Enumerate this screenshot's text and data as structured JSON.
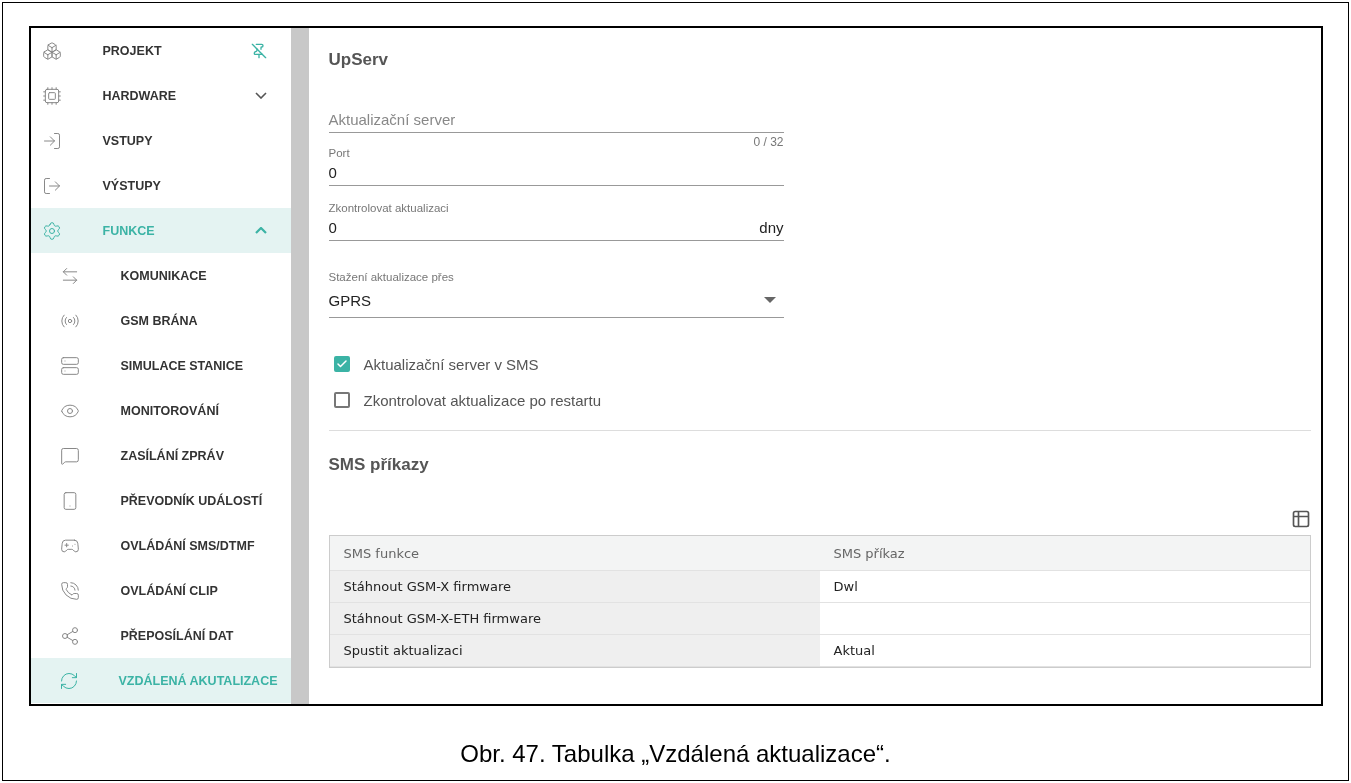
{
  "sidebar": {
    "items": [
      {
        "label": "PROJEKT",
        "selected": false,
        "pinned": true
      },
      {
        "label": "HARDWARE",
        "selected": false,
        "expanded": false
      },
      {
        "label": "VSTUPY",
        "selected": false
      },
      {
        "label": "VÝSTUPY",
        "selected": false
      },
      {
        "label": "FUNKCE",
        "selected": true,
        "expanded": true,
        "children": [
          {
            "label": "KOMUNIKACE",
            "selected": false
          },
          {
            "label": "GSM BRÁNA",
            "selected": false
          },
          {
            "label": "SIMULACE STANICE",
            "selected": false
          },
          {
            "label": "MONITOROVÁNÍ",
            "selected": false
          },
          {
            "label": "ZASÍLÁNÍ ZPRÁV",
            "selected": false
          },
          {
            "label": "PŘEVODNÍK UDÁLOSTÍ",
            "selected": false
          },
          {
            "label": "OVLÁDÁNÍ SMS/DTMF",
            "selected": false
          },
          {
            "label": "OVLÁDÁNÍ CLIP",
            "selected": false
          },
          {
            "label": "PŘEPOSÍLÁNÍ DAT",
            "selected": false
          },
          {
            "label": "VZDÁLENÁ AKUTALIZACE",
            "selected": true
          }
        ]
      }
    ]
  },
  "upserv": {
    "title": "UpServ",
    "fields": [
      {
        "kind": "text",
        "placeholder": "Aktualizační server",
        "counter": "0 / 32"
      },
      {
        "kind": "number",
        "label": "Port",
        "value": "0"
      },
      {
        "kind": "number",
        "label": "Zkontrolovat aktualizaci",
        "value": "0",
        "suffix": "dny"
      },
      {
        "kind": "select",
        "label": "Stažení aktualizace přes",
        "value": "GPRS"
      }
    ],
    "checkboxes": [
      {
        "label": "Aktualizační server v SMS",
        "checked": true
      },
      {
        "label": "Zkontrolovat aktualizace po restartu",
        "checked": false
      }
    ]
  },
  "sms": {
    "title": "SMS příkazy",
    "table": {
      "columns": [
        "SMS funkce",
        "SMS příkaz"
      ],
      "rows": [
        [
          "Stáhnout GSM-X firmware",
          "Dwl"
        ],
        [
          "Stáhnout GSM-X-ETH firmware",
          ""
        ],
        [
          "Spustit aktualizaci",
          "Aktual"
        ]
      ]
    }
  },
  "caption": "Obr. 47. Tabulka „Vzdálená aktualizace“."
}
